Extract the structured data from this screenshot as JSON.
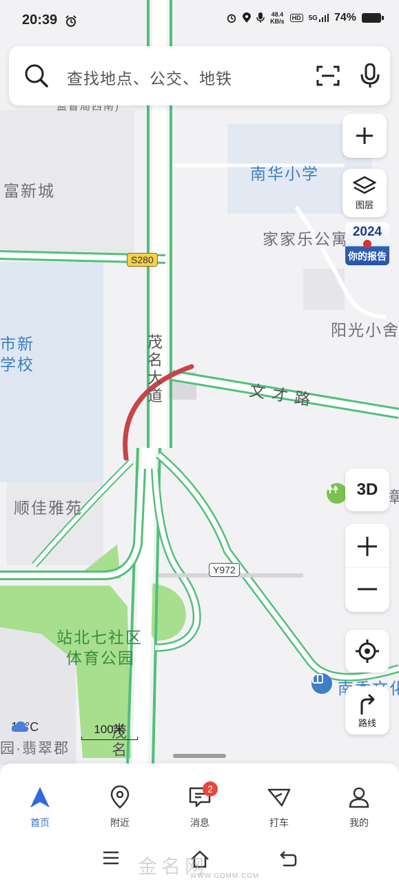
{
  "status_bar": {
    "time": "20:39",
    "net_speed_value": "48.4",
    "net_speed_unit": "KB/s",
    "hd": "HD",
    "network": "5G",
    "battery": "74%"
  },
  "search": {
    "placeholder": "查找地点、公交、地铁"
  },
  "map": {
    "labels": {
      "fu_xin_cheng": "富新城",
      "nanhua_school": "南华小学",
      "jiajiale": "家家乐公寓",
      "school_left_line1": "市新",
      "school_left_line2": "学校",
      "yangguang": "阳光小舍",
      "shunjia": "顺佳雅苑",
      "park_line1": "站北七社区",
      "park_line2": "体育公园",
      "feicui": "园·翡翠郡",
      "nanxiang": "南香文化",
      "top_partial": "监督局西南)",
      "maoming_ave": [
        "茂",
        "名",
        "大",
        "道"
      ],
      "wencai_road": "文才路",
      "maoming_bottom": [
        "茂",
        "名"
      ],
      "right_partial": "樟"
    },
    "shields": {
      "s280": "S280",
      "y972": "Y972"
    },
    "weather": "19°C",
    "scale": "100米",
    "colors": {
      "road_green": "#4fc07a",
      "park_green": "#a7df8f",
      "route_red": "#c9434a",
      "water_blue": "#dde7f3"
    }
  },
  "controls": {
    "zoom_in": "+",
    "layers_label": "图层",
    "report_year": "2024",
    "report_text": "你的报告",
    "three_d": "3D",
    "plus": "+",
    "minus": "−",
    "route_label": "路线"
  },
  "bottom_nav": {
    "items": [
      {
        "label": "首页",
        "icon": "navigation-arrow-icon",
        "active": true
      },
      {
        "label": "附近",
        "icon": "location-pin-icon"
      },
      {
        "label": "消息",
        "icon": "message-icon",
        "badge": "2"
      },
      {
        "label": "打车",
        "icon": "taxi-icon"
      },
      {
        "label": "我的",
        "icon": "user-icon"
      }
    ]
  },
  "watermark": {
    "text": "金名网",
    "url": "WWW.GDMM.COM"
  }
}
